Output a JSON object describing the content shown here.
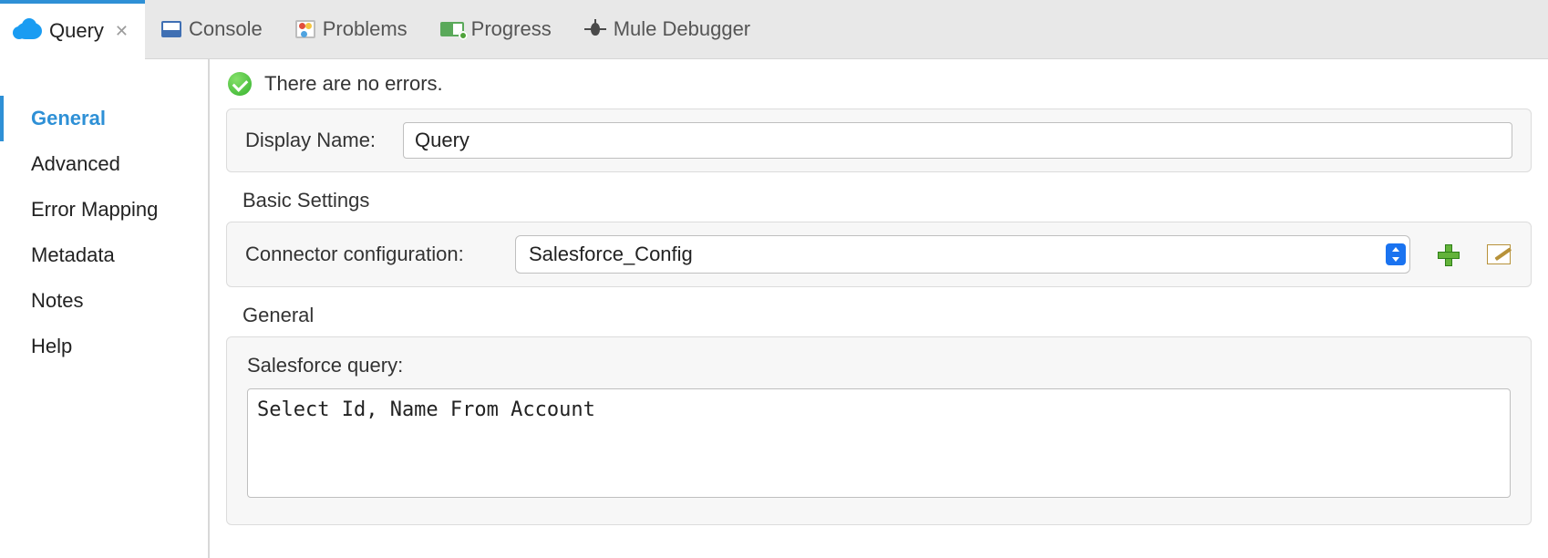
{
  "tabs": {
    "query": {
      "label": "Query"
    },
    "console": {
      "label": "Console"
    },
    "problems": {
      "label": "Problems"
    },
    "progress": {
      "label": "Progress"
    },
    "debugger": {
      "label": "Mule Debugger"
    }
  },
  "sidenav": {
    "general": "General",
    "advanced": "Advanced",
    "error_mapping": "Error Mapping",
    "metadata": "Metadata",
    "notes": "Notes",
    "help": "Help"
  },
  "status": {
    "message": "There are no errors."
  },
  "display_name": {
    "label": "Display Name:",
    "value": "Query"
  },
  "basic_settings": {
    "title": "Basic Settings",
    "connector_label": "Connector configuration:",
    "connector_value": "Salesforce_Config"
  },
  "general_section": {
    "title": "General",
    "query_label": "Salesforce query:",
    "query_value": "Select Id, Name From Account"
  }
}
